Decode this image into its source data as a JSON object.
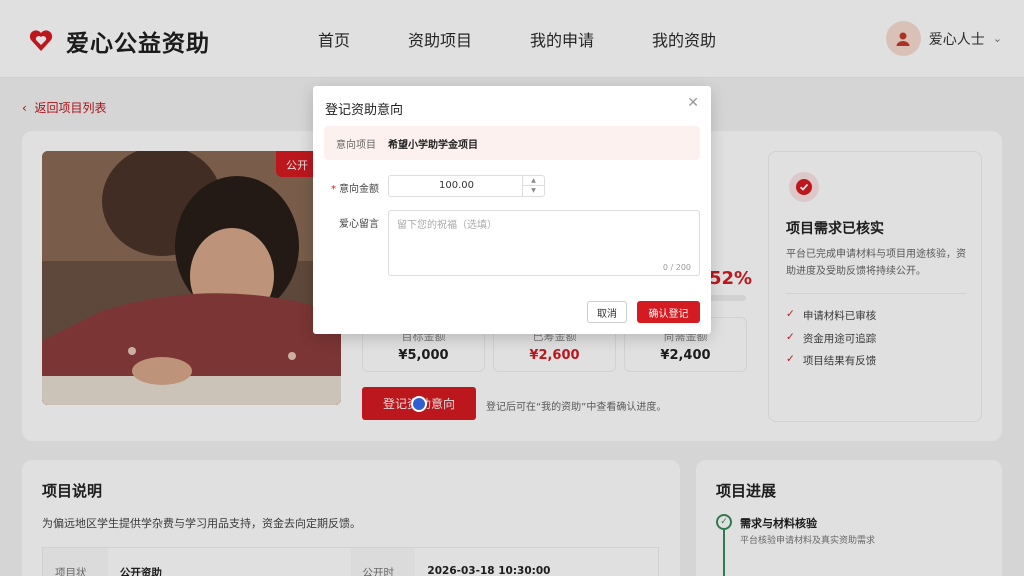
{
  "header": {
    "logo_text": "爱心公益资助",
    "nav": [
      "首页",
      "资助项目",
      "我的申请",
      "我的资助"
    ],
    "user_name": "爱心人士"
  },
  "page": {
    "back_link": "返回项目列表",
    "photo_badge": "公开",
    "progress_percent_label": "52%",
    "progress_fraction": 0.52,
    "stats": [
      {
        "label": "目标金额",
        "value": "¥5,000"
      },
      {
        "label": "已筹金额",
        "value": "¥2,600"
      },
      {
        "label": "尚需金额",
        "value": "¥2,400"
      }
    ],
    "cta_label": "登记资助意向",
    "cta_note": "登记后可在“我的资助”中查看确认进度。",
    "verify": {
      "title": "项目需求已核实",
      "desc": "平台已完成申请材料与项目用途核验，资助进度及受助反馈将持续公开。",
      "checks": [
        "申请材料已审核",
        "资金用途可追踪",
        "项目结果有反馈"
      ]
    },
    "description": {
      "title": "项目说明",
      "text": "为偏远地区学生提供学杂费与学习用品支持，资金去向定期反馈。",
      "rows": [
        {
          "k1": "项目状态",
          "v1": "公开资助",
          "k2": "公开时间",
          "v2": "2026-03-18 10:30:00"
        }
      ]
    },
    "progress_card": {
      "title": "项目进展",
      "steps": [
        {
          "title": "需求与材料核验",
          "desc": "平台核验申请材料及真实资助需求"
        }
      ]
    }
  },
  "modal": {
    "title": "登记资助意向",
    "project_label": "意向项目",
    "project_name": "希望小学助学金项目",
    "amount_label": "意向金额",
    "amount_value": "100.00",
    "message_label": "爱心留言",
    "message_placeholder": "留下您的祝福（选填）",
    "counter": "0 / 200",
    "cancel": "取消",
    "confirm": "确认登记"
  },
  "colors": {
    "accent": "#d51b22",
    "success": "#3a8a5a"
  }
}
